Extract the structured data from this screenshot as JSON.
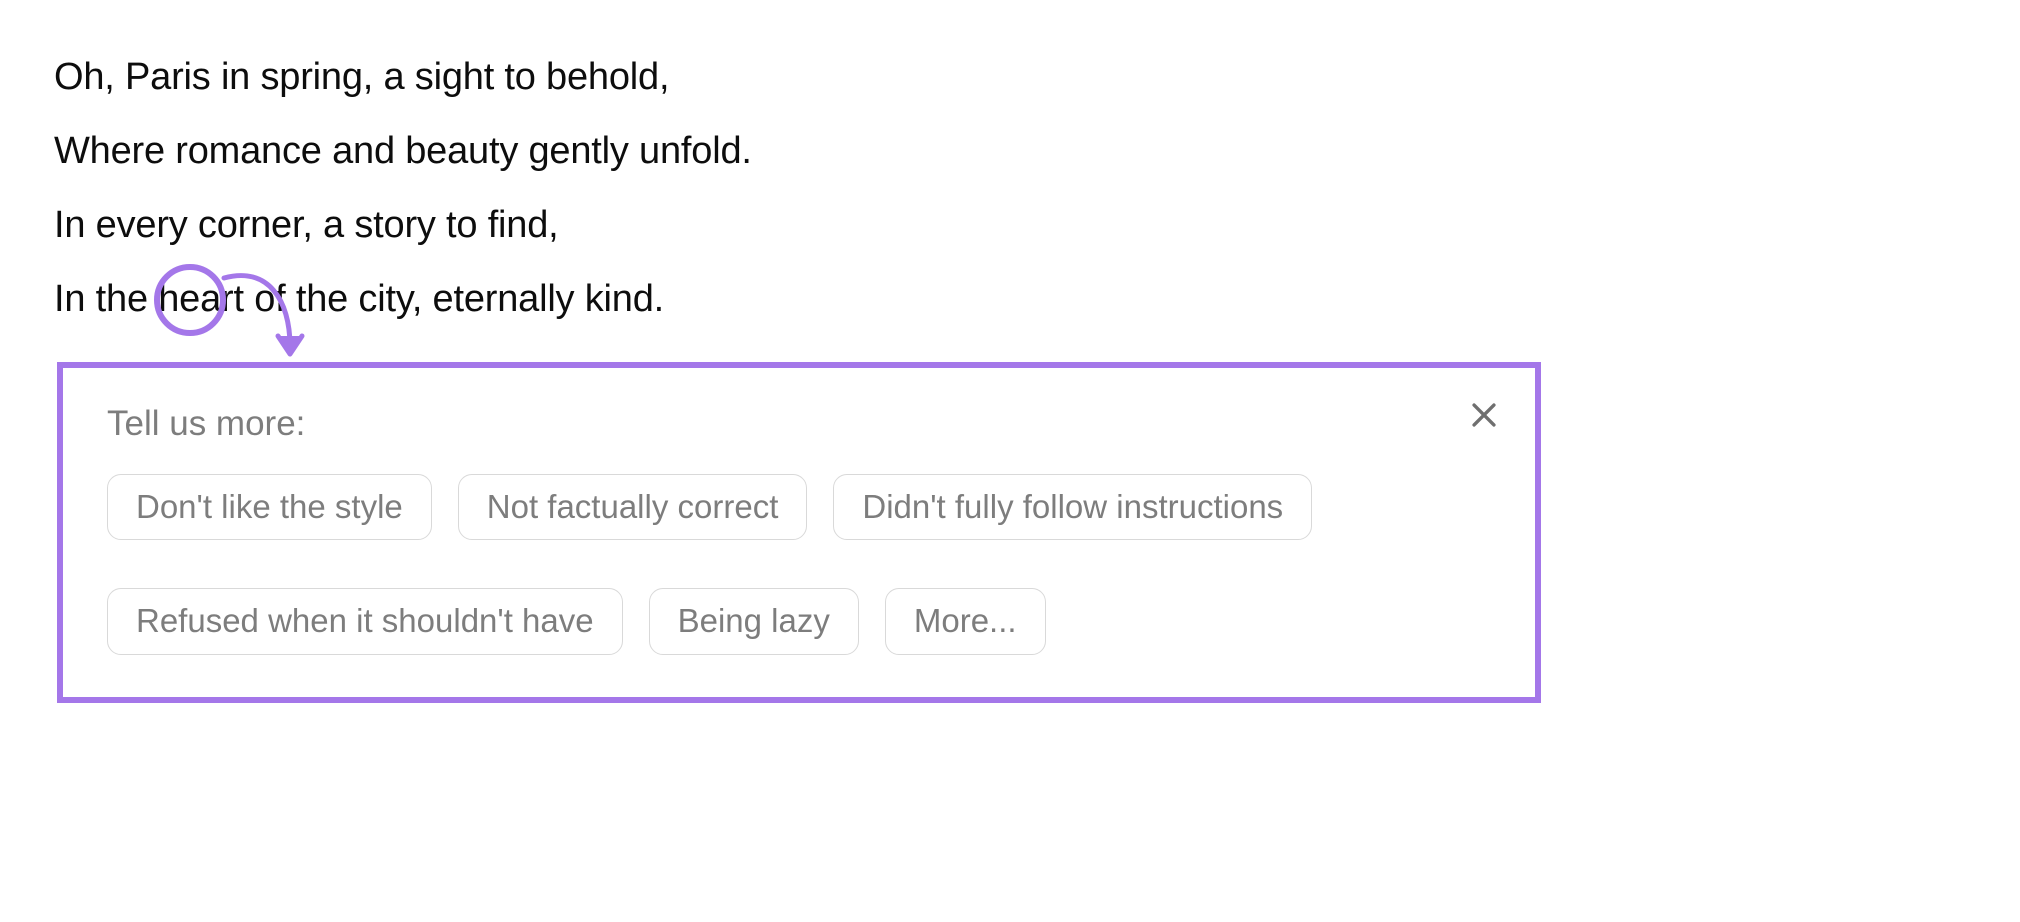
{
  "message": {
    "lines": [
      "Oh, Paris in spring, a sight to behold,",
      "Where romance and beauty gently unfold.",
      "In every corner, a story to find,",
      "In the heart of the city, eternally kind."
    ]
  },
  "actions": {
    "copy": "copy-icon",
    "regenerate": "regenerate-icon",
    "thumbs_down": "thumbs-down-icon"
  },
  "feedback": {
    "title": "Tell us more:",
    "options": [
      "Don't like the style",
      "Not factually correct",
      "Didn't fully follow instructions",
      "Refused when it shouldn't have",
      "Being lazy",
      "More..."
    ]
  },
  "annotation": {
    "highlight_color": "#a477e9"
  }
}
